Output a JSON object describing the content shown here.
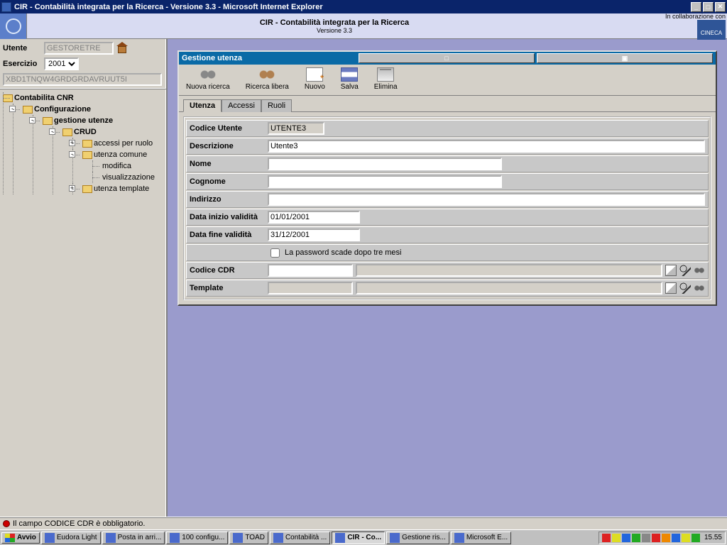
{
  "window_title": "CIR - Contabilità integrata per la Ricerca - Versione 3.3 - Microsoft Internet Explorer",
  "banner": {
    "title": "CIR - Contabilità integrata per la Ricerca",
    "subtitle": "Versione 3.3",
    "collab": "In collaborazione con",
    "badge": "CINECA"
  },
  "left": {
    "utente_label": "Utente",
    "utente_value": "GESTORETRE",
    "esercizio_label": "Esercizio",
    "esercizio_value": "2001",
    "session_id": "XBD1TNQW4GRDGRDAVRUUT5I",
    "tree": {
      "root": "Contabilita CNR",
      "n1": "Configurazione",
      "n2": "gestione utenze",
      "n3": "CRUD",
      "n4": "accessi per ruolo",
      "n5": "utenza comune",
      "n5a": "modifica",
      "n5b": "visualizzazione",
      "n6": "utenza template"
    }
  },
  "panel": {
    "title": "Gestione utenza",
    "toolbar": {
      "nuova_ricerca": "Nuova ricerca",
      "ricerca_libera": "Ricerca libera",
      "nuovo": "Nuovo",
      "salva": "Salva",
      "elimina": "Elimina"
    },
    "tabs": {
      "utenza": "Utenza",
      "accessi": "Accessi",
      "ruoli": "Ruoli"
    },
    "form": {
      "codice_utente_label": "Codice Utente",
      "codice_utente_value": "UTENTE3",
      "descrizione_label": "Descrizione",
      "descrizione_value": "Utente3",
      "nome_label": "Nome",
      "nome_value": "",
      "cognome_label": "Cognome",
      "cognome_value": "",
      "indirizzo_label": "Indirizzo",
      "indirizzo_value": "",
      "data_inizio_label": "Data inizio validità",
      "data_inizio_value": "01/01/2001",
      "data_fine_label": "Data fine validità",
      "data_fine_value": "31/12/2001",
      "password_checkbox_label": "La password scade dopo tre mesi",
      "codice_cdr_label": "Codice CDR",
      "template_label": "Template"
    }
  },
  "status": "Il campo CODICE CDR è obbligatorio.",
  "taskbar": {
    "start": "Avvio",
    "items": [
      "Eudora Light",
      "Posta in arri...",
      "100 configu...",
      "TOAD",
      "Contabilità ...",
      "CIR - Co...",
      "Gestione ris...",
      "Microsoft E..."
    ],
    "clock": "15.55"
  }
}
